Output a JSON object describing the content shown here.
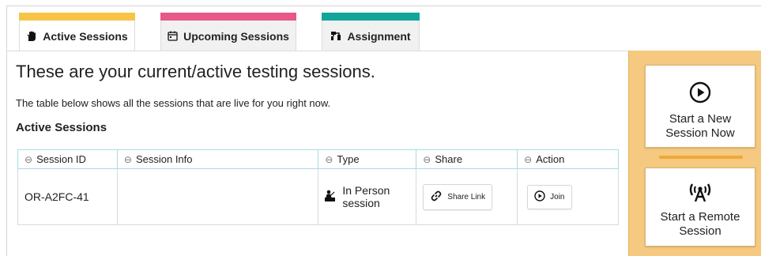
{
  "tabs": [
    {
      "label": "Active Sessions",
      "icon": "hand-icon",
      "color": "#f7c347",
      "active": true
    },
    {
      "label": "Upcoming Sessions",
      "icon": "calendar-icon",
      "color": "#e8588a",
      "active": false
    },
    {
      "label": "Assignment",
      "icon": "tree-icon",
      "color": "#12a59a",
      "active": false
    }
  ],
  "main": {
    "headline": "These are your current/active testing sessions.",
    "subtext": "The table below shows all the sessions that are live for you right now.",
    "section_title": "Active Sessions"
  },
  "table": {
    "columns": [
      "Session ID",
      "Session Info",
      "Type",
      "Share",
      "Action"
    ],
    "rows": [
      {
        "session_id": "OR-A2FC-41",
        "session_info": "",
        "type": "In Person session",
        "share_label": "Share Link",
        "action_label": "Join"
      }
    ]
  },
  "sidebar": {
    "new_session_label": "Start a New Session Now",
    "remote_session_label": "Start a Remote Session",
    "background_color": "#f5c97f",
    "divider_color": "#f0a83a"
  }
}
